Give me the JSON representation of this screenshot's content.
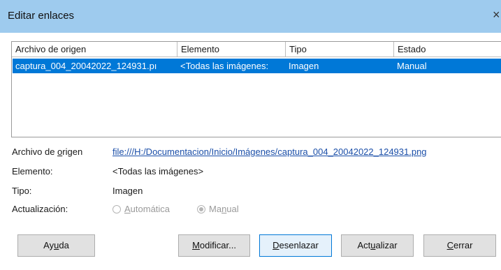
{
  "window": {
    "title": "Editar enlaces",
    "close_glyph": "×"
  },
  "table": {
    "headers": [
      "Archivo de origen",
      "Elemento",
      "Tipo",
      "Estado"
    ],
    "rows": [
      {
        "archivo": "captura_004_20042022_124931.pı",
        "elemento": "<Todas las imágenes:",
        "tipo": "Imagen",
        "estado": "Manual",
        "selected": true
      }
    ]
  },
  "details": {
    "archivo_label_pre": "Archivo de ",
    "archivo_label_mn": "o",
    "archivo_label_post": "rigen",
    "archivo_value": "file:///H:/Documentacion/Inicio/Imágenes/captura_004_20042022_124931.png",
    "elemento_label": "Elemento:",
    "elemento_value": "<Todas las imágenes>",
    "tipo_label": "Tipo:",
    "tipo_value": "Imagen",
    "actualizacion_label": "Actualización:",
    "auto_label_mn": "A",
    "auto_label_rest": "utomática",
    "manual_label_pre": "Ma",
    "manual_label_mn": "n",
    "manual_label_post": "ual",
    "update_mode": "Manual"
  },
  "buttons": {
    "ayuda_pre": "Ay",
    "ayuda_mn": "u",
    "ayuda_post": "da",
    "modificar_mn": "M",
    "modificar_post": "odificar...",
    "desenlazar_mn": "D",
    "desenlazar_post": "esenlazar",
    "actualizar_pre": "Act",
    "actualizar_mn": "u",
    "actualizar_post": "alizar",
    "cerrar_mn": "C",
    "cerrar_post": "errar"
  },
  "colors": {
    "titlebar": "#9ecbee",
    "selection": "#0078d7",
    "link": "#1a4ea8"
  }
}
